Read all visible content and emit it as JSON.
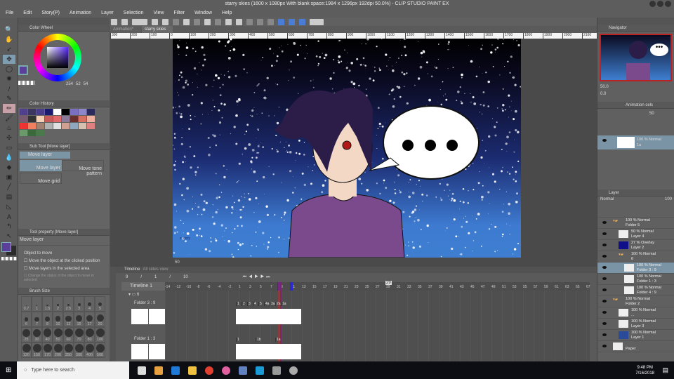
{
  "title": "starry skies (1600 x 1080px With blank space:1984 x 1296px 192dpi 50.0%)  - CLIP STUDIO PAINT EX",
  "menu": [
    "File",
    "Edit",
    "Story(P)",
    "Animation",
    "Layer",
    "Selection",
    "View",
    "Filter",
    "Window",
    "Help"
  ],
  "color_wheel": {
    "tab": "Color Wheel",
    "h": "254",
    "s": "52",
    "v": "54",
    "main_color": "#5b3f9a",
    "sub_color": "#2b2b2b"
  },
  "color_history": {
    "tab": "Color History",
    "swatches": [
      "#4f3f8c",
      "#3a3660",
      "#4a3d8a",
      "#1c1a70",
      "#ffffff",
      "#000000",
      "#7a6fc0",
      "#8e86c8",
      "#2a2a5c",
      "#7a5a70",
      "#333333",
      "#f3d2b8",
      "#c95a5a",
      "#e06a6a",
      "#8a7a9a",
      "#6a3030",
      "#d56f5f",
      "#f0b0a0",
      "#ee3333",
      "#f08060",
      "#a08070",
      "#b0b0b0",
      "#e0e0e0",
      "#d0a090",
      "#8fa8c0",
      "#d6c0b0",
      "#e08080",
      "#6a9a6a",
      "#3a6a3a",
      "#4a7a4a"
    ]
  },
  "sub_tool": {
    "tab": "Sub Tool [Move layer]",
    "group": "Move layer",
    "items": [
      "Move layer",
      "Move tone pattern",
      "Move grid"
    ]
  },
  "tool_property": {
    "tab": "Tool property [Move layer]",
    "name": "Move layer",
    "object_to_move": "Object to move",
    "options": [
      "Move the object at the clicked position",
      "Move layers in the selected area",
      "Change the status of the object to move to selected"
    ]
  },
  "brush_size": {
    "tab": "Brush Size",
    "sizes": [
      "0.7",
      "1",
      "1.5",
      "2",
      "2.5",
      "3",
      "4",
      "5",
      "6",
      "7",
      "8",
      "10",
      "12",
      "15",
      "17",
      "20",
      "25",
      "30",
      "40",
      "50",
      "60",
      "70",
      "80",
      "100",
      "120",
      "150",
      "170",
      "200",
      "250",
      "300",
      "400",
      "500"
    ]
  },
  "doc_tabs": [
    "Animation*",
    "starry skies"
  ],
  "ruler": [
    "300",
    "200",
    "100",
    "0",
    "100",
    "200",
    "300",
    "400",
    "500",
    "600",
    "700",
    "800",
    "900",
    "1000",
    "1100",
    "1200",
    "1300",
    "1400",
    "1500",
    "1600",
    "1700",
    "1800",
    "1900",
    "2000",
    "2100",
    "2200",
    "2300"
  ],
  "canvas": {
    "zoom": "50",
    "signature": "z.story"
  },
  "timeline": {
    "tabs": [
      "Timeline",
      "All sides view"
    ],
    "frame_controls": [
      "9",
      "/",
      "1",
      "/",
      "10"
    ],
    "name": "Timeline 1",
    "current_frame": "29",
    "ticks": [
      "-14",
      "-12",
      "-10",
      "-8",
      "-6",
      "-4",
      "-2",
      "1",
      "3",
      "5",
      "7",
      "9",
      "11",
      "13",
      "15",
      "17",
      "19",
      "21",
      "23",
      "25",
      "27",
      "29",
      "31",
      "33",
      "35",
      "37",
      "39",
      "41",
      "43",
      "45",
      "47",
      "49",
      "51",
      "53",
      "55",
      "57",
      "59",
      "61",
      "63",
      "65",
      "67"
    ],
    "tracks": [
      {
        "name": "6"
      },
      {
        "name": "Folder 3 : 9",
        "cels": [
          "1",
          "2",
          "3",
          "4",
          "5",
          "4a",
          "3a",
          "2a",
          "1a"
        ],
        "thumbs": [
          "1",
          "2"
        ]
      },
      {
        "name": "Folder 1 : 3",
        "cels": [
          "1",
          "1b",
          "1a"
        ]
      }
    ]
  },
  "navigator": {
    "tab": "Navigator",
    "zoom": "50.0",
    "rotation": "0.0"
  },
  "animation_cels": {
    "tab": "Animation cels",
    "opacity": "50",
    "cel": {
      "mode": "100 % Normal",
      "name": "1a"
    }
  },
  "layers": {
    "tab": "Layer",
    "blend": "Normal",
    "opacity": "100",
    "rows": [
      {
        "mode": "100 % Normal",
        "name": "Folder 5",
        "indent": 0,
        "folder": true
      },
      {
        "mode": "50 % Normal",
        "name": "Layer 4",
        "indent": 1
      },
      {
        "mode": "27 % Overlay",
        "name": "Layer 2",
        "indent": 1
      },
      {
        "mode": "100 % Normal",
        "name": "6",
        "indent": 1,
        "folder": true
      },
      {
        "mode": "100 % Normal",
        "name": "Folder 3 : 9",
        "indent": 2,
        "selected": true
      },
      {
        "mode": "100 % Normal",
        "name": "Folder 1 : 3",
        "indent": 2
      },
      {
        "mode": "100 % Normal",
        "name": "Folder 4 : 9",
        "indent": 2
      },
      {
        "mode": "100 % Normal",
        "name": "Folder 2",
        "indent": 0,
        "folder": true
      },
      {
        "mode": "100 % Normal",
        "name": "...",
        "indent": 1
      },
      {
        "mode": "100 % Normal",
        "name": "Layer 3",
        "indent": 1
      },
      {
        "mode": "100 % Normal",
        "name": "Layer 1",
        "indent": 1
      },
      {
        "mode": "",
        "name": "Paper",
        "indent": 0
      }
    ]
  },
  "taskbar": {
    "search_placeholder": "Type here to search",
    "time": "9:48 PM",
    "date": "7/16/2018"
  }
}
